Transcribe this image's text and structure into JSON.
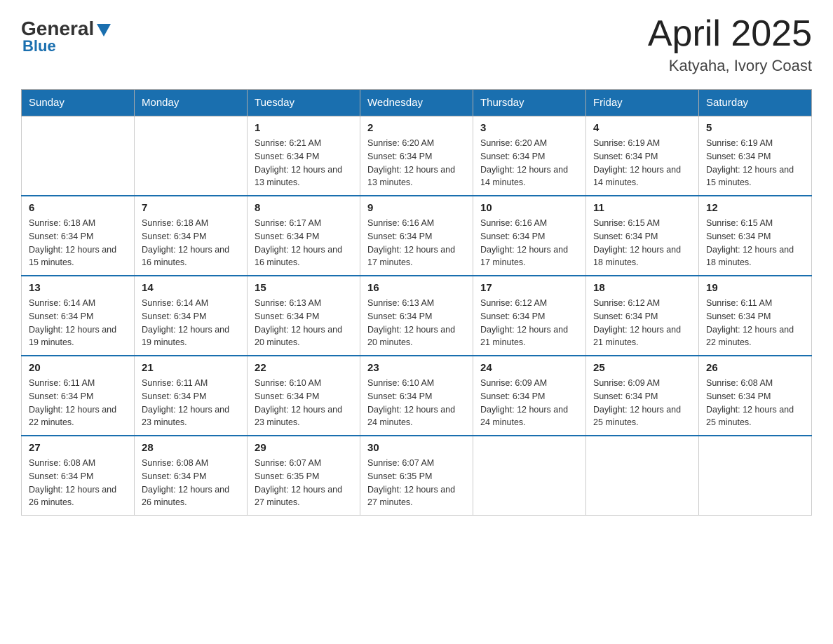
{
  "header": {
    "logo": {
      "general": "General",
      "blue": "Blue"
    },
    "title": "April 2025",
    "location": "Katyaha, Ivory Coast"
  },
  "days_of_week": [
    "Sunday",
    "Monday",
    "Tuesday",
    "Wednesday",
    "Thursday",
    "Friday",
    "Saturday"
  ],
  "weeks": [
    [
      {
        "day": "",
        "sunrise": "",
        "sunset": "",
        "daylight": ""
      },
      {
        "day": "",
        "sunrise": "",
        "sunset": "",
        "daylight": ""
      },
      {
        "day": "1",
        "sunrise": "Sunrise: 6:21 AM",
        "sunset": "Sunset: 6:34 PM",
        "daylight": "Daylight: 12 hours and 13 minutes."
      },
      {
        "day": "2",
        "sunrise": "Sunrise: 6:20 AM",
        "sunset": "Sunset: 6:34 PM",
        "daylight": "Daylight: 12 hours and 13 minutes."
      },
      {
        "day": "3",
        "sunrise": "Sunrise: 6:20 AM",
        "sunset": "Sunset: 6:34 PM",
        "daylight": "Daylight: 12 hours and 14 minutes."
      },
      {
        "day": "4",
        "sunrise": "Sunrise: 6:19 AM",
        "sunset": "Sunset: 6:34 PM",
        "daylight": "Daylight: 12 hours and 14 minutes."
      },
      {
        "day": "5",
        "sunrise": "Sunrise: 6:19 AM",
        "sunset": "Sunset: 6:34 PM",
        "daylight": "Daylight: 12 hours and 15 minutes."
      }
    ],
    [
      {
        "day": "6",
        "sunrise": "Sunrise: 6:18 AM",
        "sunset": "Sunset: 6:34 PM",
        "daylight": "Daylight: 12 hours and 15 minutes."
      },
      {
        "day": "7",
        "sunrise": "Sunrise: 6:18 AM",
        "sunset": "Sunset: 6:34 PM",
        "daylight": "Daylight: 12 hours and 16 minutes."
      },
      {
        "day": "8",
        "sunrise": "Sunrise: 6:17 AM",
        "sunset": "Sunset: 6:34 PM",
        "daylight": "Daylight: 12 hours and 16 minutes."
      },
      {
        "day": "9",
        "sunrise": "Sunrise: 6:16 AM",
        "sunset": "Sunset: 6:34 PM",
        "daylight": "Daylight: 12 hours and 17 minutes."
      },
      {
        "day": "10",
        "sunrise": "Sunrise: 6:16 AM",
        "sunset": "Sunset: 6:34 PM",
        "daylight": "Daylight: 12 hours and 17 minutes."
      },
      {
        "day": "11",
        "sunrise": "Sunrise: 6:15 AM",
        "sunset": "Sunset: 6:34 PM",
        "daylight": "Daylight: 12 hours and 18 minutes."
      },
      {
        "day": "12",
        "sunrise": "Sunrise: 6:15 AM",
        "sunset": "Sunset: 6:34 PM",
        "daylight": "Daylight: 12 hours and 18 minutes."
      }
    ],
    [
      {
        "day": "13",
        "sunrise": "Sunrise: 6:14 AM",
        "sunset": "Sunset: 6:34 PM",
        "daylight": "Daylight: 12 hours and 19 minutes."
      },
      {
        "day": "14",
        "sunrise": "Sunrise: 6:14 AM",
        "sunset": "Sunset: 6:34 PM",
        "daylight": "Daylight: 12 hours and 19 minutes."
      },
      {
        "day": "15",
        "sunrise": "Sunrise: 6:13 AM",
        "sunset": "Sunset: 6:34 PM",
        "daylight": "Daylight: 12 hours and 20 minutes."
      },
      {
        "day": "16",
        "sunrise": "Sunrise: 6:13 AM",
        "sunset": "Sunset: 6:34 PM",
        "daylight": "Daylight: 12 hours and 20 minutes."
      },
      {
        "day": "17",
        "sunrise": "Sunrise: 6:12 AM",
        "sunset": "Sunset: 6:34 PM",
        "daylight": "Daylight: 12 hours and 21 minutes."
      },
      {
        "day": "18",
        "sunrise": "Sunrise: 6:12 AM",
        "sunset": "Sunset: 6:34 PM",
        "daylight": "Daylight: 12 hours and 21 minutes."
      },
      {
        "day": "19",
        "sunrise": "Sunrise: 6:11 AM",
        "sunset": "Sunset: 6:34 PM",
        "daylight": "Daylight: 12 hours and 22 minutes."
      }
    ],
    [
      {
        "day": "20",
        "sunrise": "Sunrise: 6:11 AM",
        "sunset": "Sunset: 6:34 PM",
        "daylight": "Daylight: 12 hours and 22 minutes."
      },
      {
        "day": "21",
        "sunrise": "Sunrise: 6:11 AM",
        "sunset": "Sunset: 6:34 PM",
        "daylight": "Daylight: 12 hours and 23 minutes."
      },
      {
        "day": "22",
        "sunrise": "Sunrise: 6:10 AM",
        "sunset": "Sunset: 6:34 PM",
        "daylight": "Daylight: 12 hours and 23 minutes."
      },
      {
        "day": "23",
        "sunrise": "Sunrise: 6:10 AM",
        "sunset": "Sunset: 6:34 PM",
        "daylight": "Daylight: 12 hours and 24 minutes."
      },
      {
        "day": "24",
        "sunrise": "Sunrise: 6:09 AM",
        "sunset": "Sunset: 6:34 PM",
        "daylight": "Daylight: 12 hours and 24 minutes."
      },
      {
        "day": "25",
        "sunrise": "Sunrise: 6:09 AM",
        "sunset": "Sunset: 6:34 PM",
        "daylight": "Daylight: 12 hours and 25 minutes."
      },
      {
        "day": "26",
        "sunrise": "Sunrise: 6:08 AM",
        "sunset": "Sunset: 6:34 PM",
        "daylight": "Daylight: 12 hours and 25 minutes."
      }
    ],
    [
      {
        "day": "27",
        "sunrise": "Sunrise: 6:08 AM",
        "sunset": "Sunset: 6:34 PM",
        "daylight": "Daylight: 12 hours and 26 minutes."
      },
      {
        "day": "28",
        "sunrise": "Sunrise: 6:08 AM",
        "sunset": "Sunset: 6:34 PM",
        "daylight": "Daylight: 12 hours and 26 minutes."
      },
      {
        "day": "29",
        "sunrise": "Sunrise: 6:07 AM",
        "sunset": "Sunset: 6:35 PM",
        "daylight": "Daylight: 12 hours and 27 minutes."
      },
      {
        "day": "30",
        "sunrise": "Sunrise: 6:07 AM",
        "sunset": "Sunset: 6:35 PM",
        "daylight": "Daylight: 12 hours and 27 minutes."
      },
      {
        "day": "",
        "sunrise": "",
        "sunset": "",
        "daylight": ""
      },
      {
        "day": "",
        "sunrise": "",
        "sunset": "",
        "daylight": ""
      },
      {
        "day": "",
        "sunrise": "",
        "sunset": "",
        "daylight": ""
      }
    ]
  ]
}
